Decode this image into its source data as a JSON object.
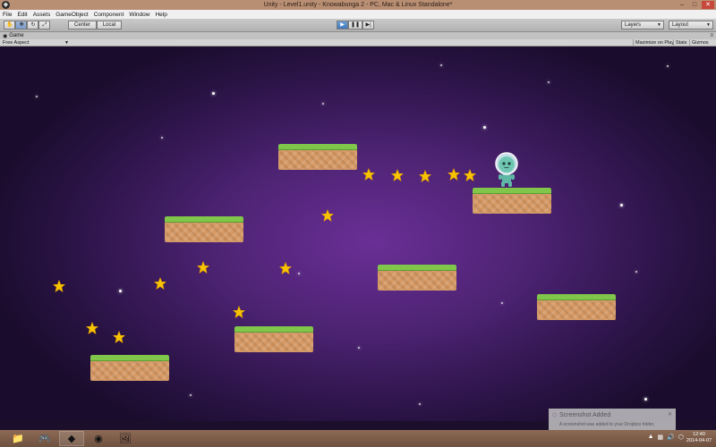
{
  "window": {
    "title": "Unity - Level1.unity - Knowabunga 2 - PC, Mac & Linux Standalone*",
    "minimize_glyph": "–",
    "maximize_glyph": "□",
    "close_glyph": "✕"
  },
  "menu": [
    "File",
    "Edit",
    "Assets",
    "GameObject",
    "Component",
    "Window",
    "Help"
  ],
  "toolbar": {
    "tools": [
      "hand-tool",
      "move-tool",
      "rotate-tool",
      "scale-tool"
    ],
    "pivot_label": "Center",
    "space_label": "Local",
    "play_glyph": "▶",
    "pause_glyph": "❚❚",
    "step_glyph": "▶|",
    "layers_label": "Layers",
    "layout_label": "Layout"
  },
  "game_panel": {
    "tab_label": "Game",
    "aspect": "Free Aspect",
    "maximize_label": "Maximize on Play",
    "stats_label": "Stats",
    "gizmos_label": "Gizmos"
  },
  "game_scene": {
    "platforms": 7,
    "stars": 15,
    "colors": {
      "grass": "#7fc64a",
      "dirt": "#d69a66",
      "star": "#f6c400",
      "character": "#6fc7b3"
    }
  },
  "notification": {
    "title": "Screenshot Added",
    "body": "A screenshot was added to your Dropbox folder."
  },
  "taskbar": {
    "apps": [
      "file-explorer",
      "game-controller",
      "unity",
      "chrome",
      "photos"
    ],
    "time": "12:40",
    "date": "2014-04-07"
  }
}
